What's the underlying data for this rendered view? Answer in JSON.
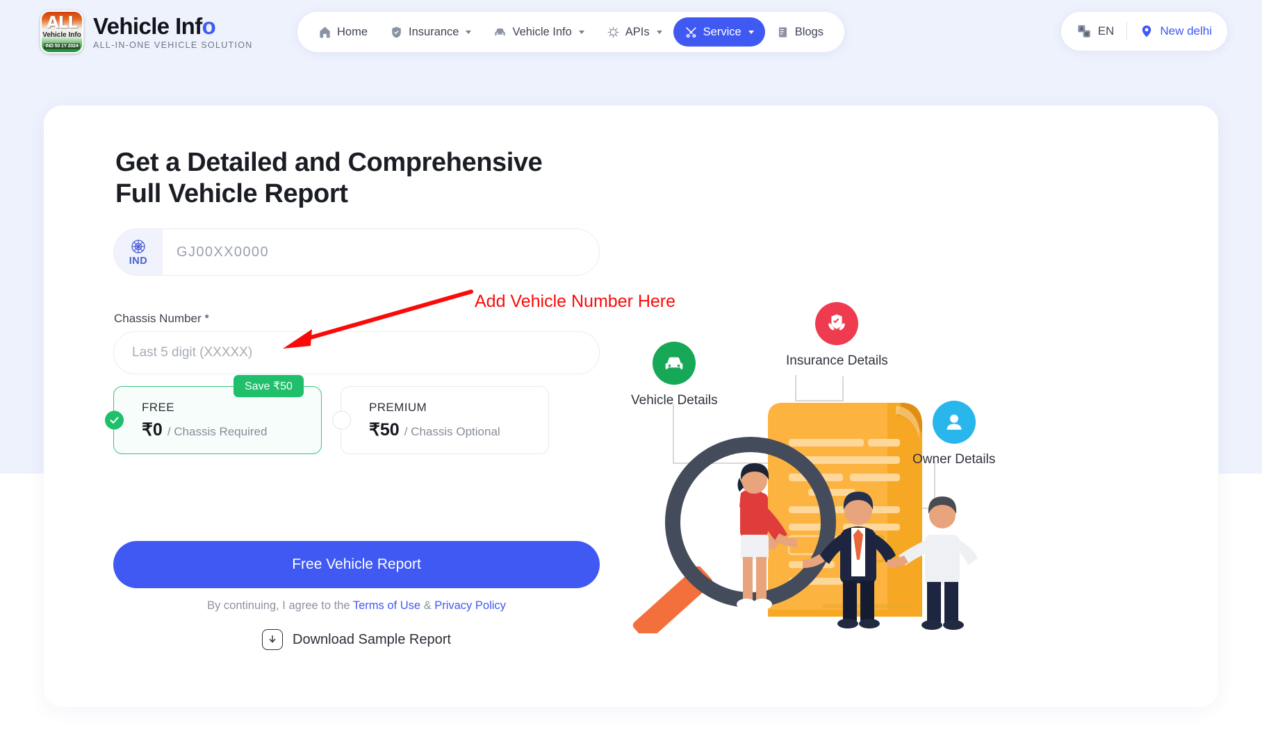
{
  "brand": {
    "logo_line1": "ALL",
    "logo_line2": "Vehicle Info",
    "logo_line3": "·IND 50 1Y 2024·",
    "title_main": "Vehicle Inf",
    "title_accent": "o",
    "subtitle": "ALL-IN-ONE VEHICLE SOLUTION",
    "logo_icon": "india-flag-badge-icon"
  },
  "nav": {
    "items": [
      {
        "label": "Home",
        "icon": "home-icon",
        "caret": false,
        "active": false
      },
      {
        "label": "Insurance",
        "icon": "shield-check-icon",
        "caret": true,
        "active": false
      },
      {
        "label": "Vehicle Info",
        "icon": "car-icon",
        "caret": true,
        "active": false
      },
      {
        "label": "APIs",
        "icon": "api-gear-icon",
        "caret": true,
        "active": false
      },
      {
        "label": "Service",
        "icon": "tools-icon",
        "caret": true,
        "active": true
      },
      {
        "label": "Blogs",
        "icon": "blog-document-icon",
        "caret": false,
        "active": false
      }
    ]
  },
  "topright": {
    "language": "EN",
    "language_icon": "translate-icon",
    "location": "New delhi",
    "location_icon": "map-pin-icon"
  },
  "hero": {
    "heading_line1": "Get a Detailed and Comprehensive",
    "heading_line2": "Full Vehicle Report"
  },
  "annotation": {
    "text": "Add Vehicle Number Here",
    "color": "#fb0a0a",
    "arrow_icon": "red-arrow-icon"
  },
  "form": {
    "country_code": "IND",
    "country_icon": "ashoka-chakra-emblem-icon",
    "vehicle_number_value": "",
    "vehicle_number_placeholder": "GJ00XX0000",
    "chassis_label": "Chassis Number *",
    "chassis_value": "",
    "chassis_placeholder": "Last 5 digit (XXXXX)",
    "submit_label": "Free Vehicle Report",
    "terms_prefix": "By continuing, I agree to the ",
    "terms_link": "Terms of Use",
    "terms_sep": " & ",
    "privacy_link": "Privacy Policy",
    "download_label": "Download Sample Report",
    "download_icon": "download-icon"
  },
  "plans": {
    "save_badge": "Save ₹50",
    "free": {
      "name": "FREE",
      "price": "₹0",
      "note": "/ Chassis Required",
      "selected": true,
      "accent": "#20bf6b"
    },
    "premium": {
      "name": "PREMIUM",
      "price": "₹50",
      "note": "/ Chassis Optional",
      "selected": false
    }
  },
  "illustration": {
    "callouts": [
      {
        "label": "Vehicle Details",
        "icon": "car-circle-icon",
        "color": "#16a857"
      },
      {
        "label": "Insurance Details",
        "icon": "insurance-shield-hands-icon",
        "color": "#ef3b4f"
      },
      {
        "label": "Owner Details",
        "icon": "user-circle-icon",
        "color": "#29b6ec"
      }
    ],
    "scene_icon": "document-magnifier-people-illustration"
  },
  "colors": {
    "page_top_bg": "#eef2fd",
    "page_bottom_bg": "#ffffff",
    "brand_blue": "#4059f3",
    "green": "#20bf6b",
    "red": "#fb0a0a"
  }
}
